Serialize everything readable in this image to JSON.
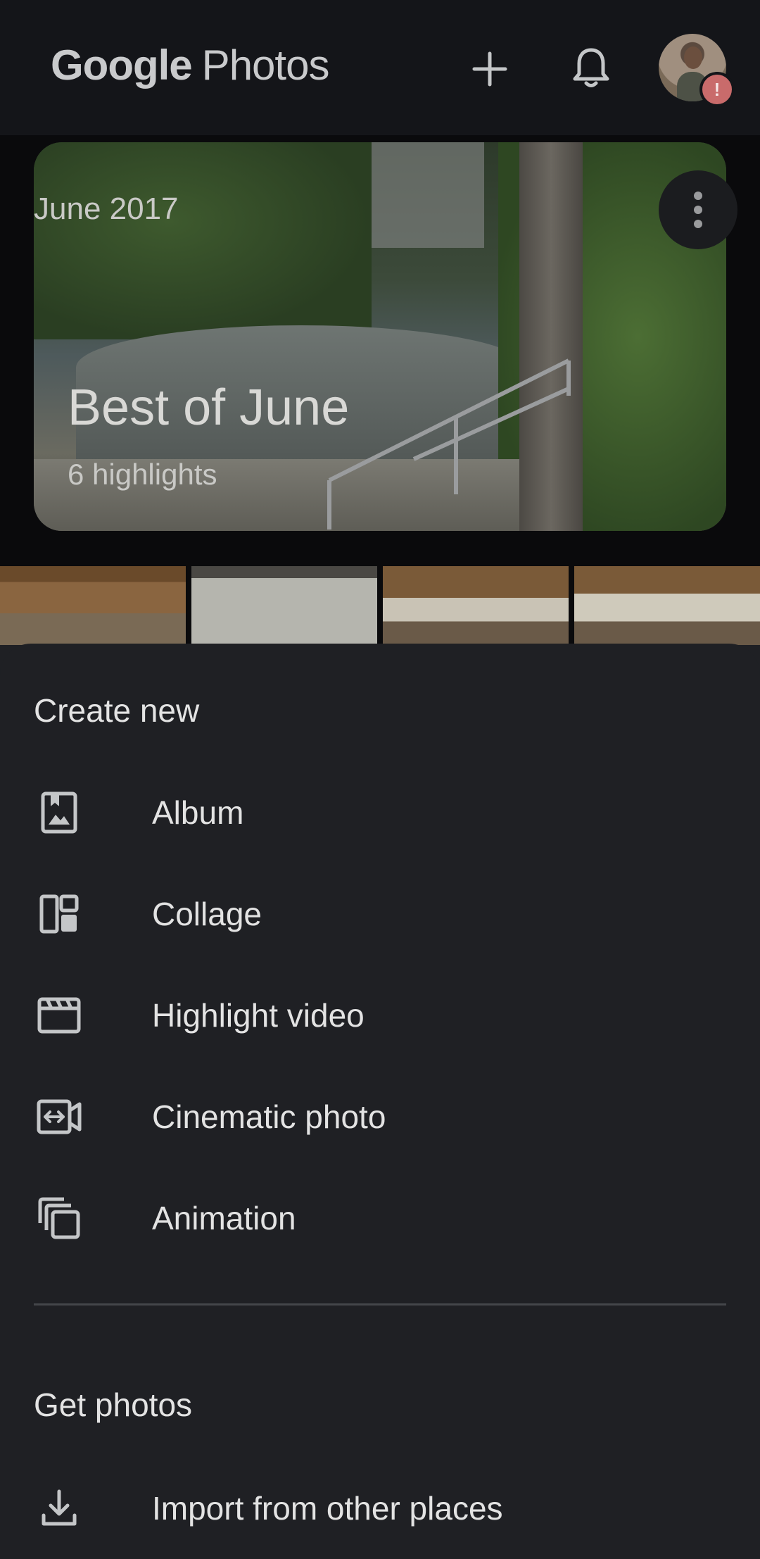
{
  "appbar": {
    "logo_google": "Google",
    "logo_photos": "Photos"
  },
  "memory": {
    "date": "June 2017",
    "title": "Best of June",
    "subtitle": "6 highlights"
  },
  "sheet": {
    "create_title": "Create new",
    "create_items": [
      {
        "label": "Album",
        "icon": "album-icon"
      },
      {
        "label": "Collage",
        "icon": "collage-icon"
      },
      {
        "label": "Highlight video",
        "icon": "highlight-video-icon"
      },
      {
        "label": "Cinematic photo",
        "icon": "cinematic-photo-icon"
      },
      {
        "label": "Animation",
        "icon": "animation-icon"
      }
    ],
    "get_title": "Get photos",
    "get_items": [
      {
        "label": "Import from other places",
        "icon": "download-icon"
      }
    ]
  },
  "colors": {
    "appbar_bg": "#141519",
    "sheet_bg": "#1f2024",
    "text": "#e3e3e3",
    "icon": "#c4c6c8",
    "badge": "#c96b6b"
  }
}
